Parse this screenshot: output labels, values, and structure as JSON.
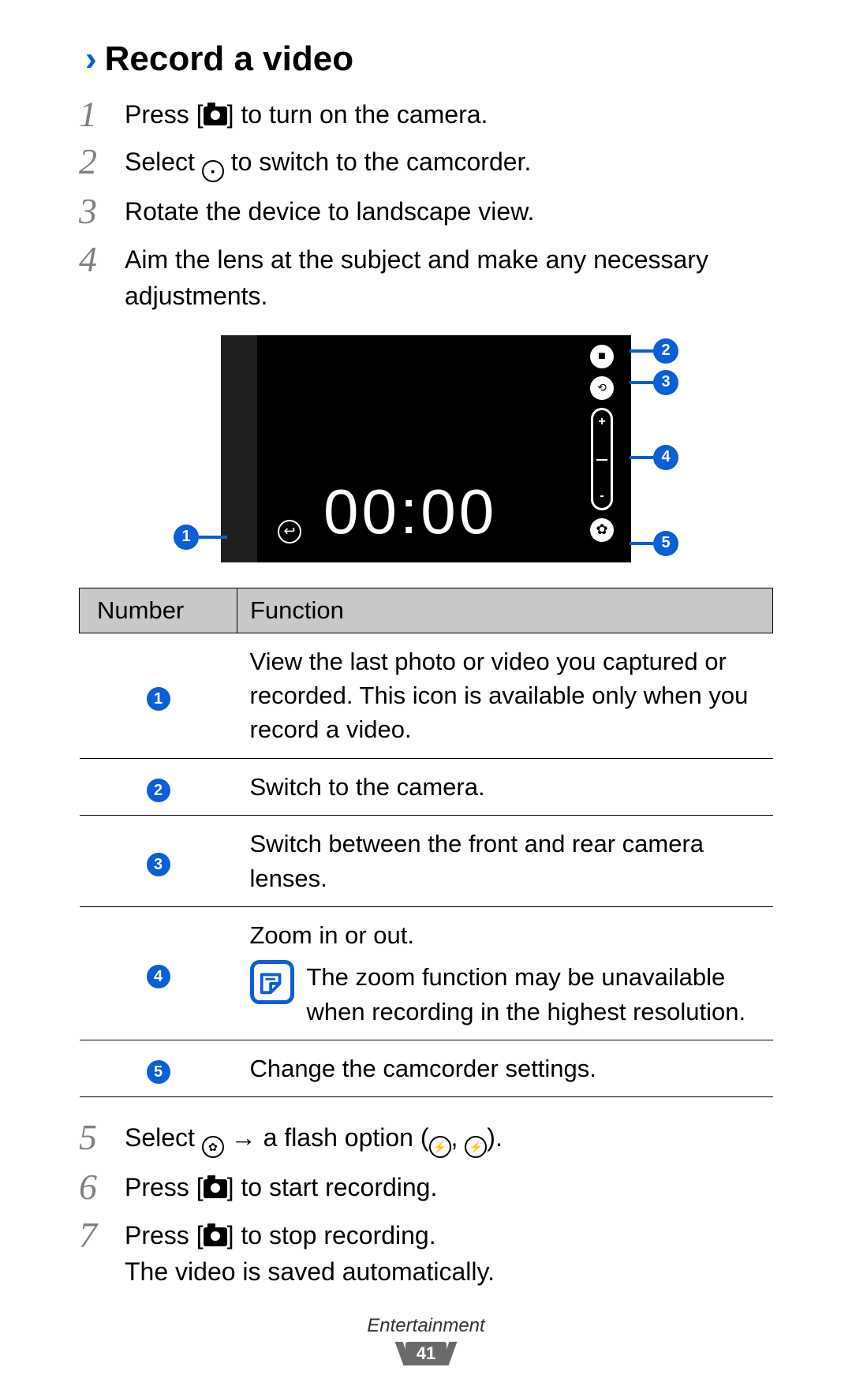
{
  "heading": {
    "marker": "›",
    "title": "Record a video"
  },
  "steps": {
    "s1": {
      "num": "1",
      "pre": "Press [",
      "post": "] to turn on the camera."
    },
    "s2": {
      "num": "2",
      "pre": "Select ",
      "post": " to switch to the camcorder."
    },
    "s3": {
      "num": "3",
      "text": "Rotate the device to landscape view."
    },
    "s4": {
      "num": "4",
      "text": "Aim the lens at the subject and make any necessary adjustments."
    },
    "s5": {
      "num": "5",
      "pre": "Select ",
      "mid1": " → a flash option (",
      "comma": ", ",
      "post": ")."
    },
    "s6": {
      "num": "6",
      "pre": "Press [",
      "post": "] to start recording."
    },
    "s7": {
      "num": "7",
      "pre": "Press [",
      "mid": "] to stop recording.",
      "line2": "The video is saved automatically."
    }
  },
  "illustration": {
    "timer": "00:00",
    "labels": {
      "l1": "1",
      "l2": "2",
      "l3": "3",
      "l4": "4",
      "l5": "5"
    },
    "zoom_plus": "+",
    "zoom_minus": "-"
  },
  "table": {
    "head_number": "Number",
    "head_function": "Function",
    "rows": [
      {
        "n": "1",
        "fn": "View the last photo or video you captured or recorded. This icon is available only when you record a video."
      },
      {
        "n": "2",
        "fn": "Switch to the camera."
      },
      {
        "n": "3",
        "fn": "Switch between the front and rear camera lenses."
      },
      {
        "n": "4",
        "fn_intro": "Zoom in or out.",
        "note": "The zoom function may be unavailable when recording in the highest resolution."
      },
      {
        "n": "5",
        "fn": "Change the camcorder settings."
      }
    ]
  },
  "footer": {
    "section": "Entertainment",
    "page": "41"
  }
}
